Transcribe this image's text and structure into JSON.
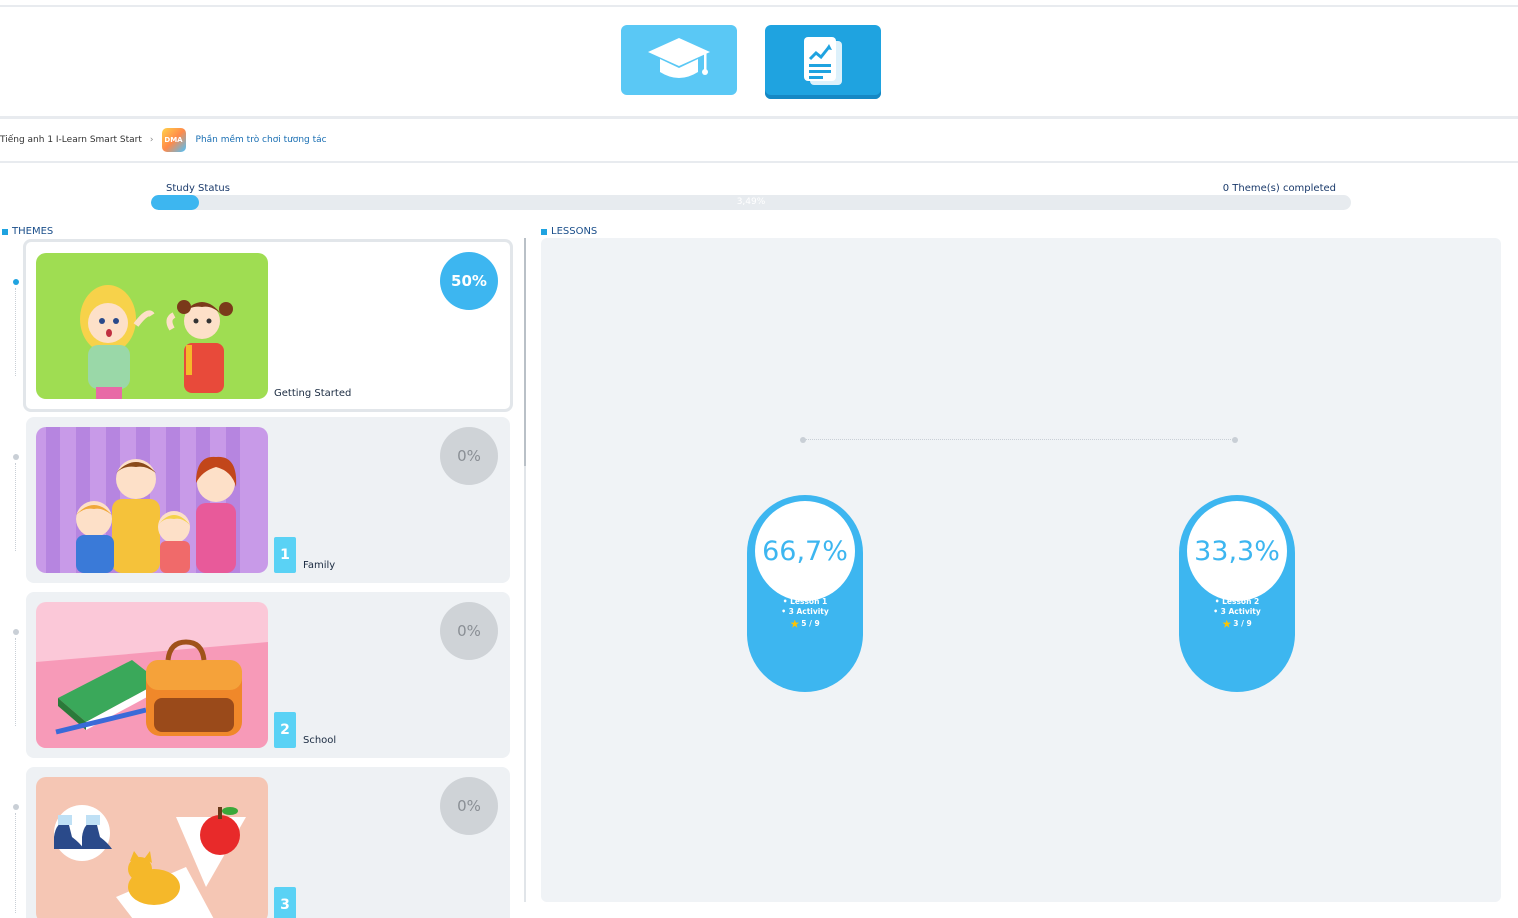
{
  "tabs": [
    {
      "name": "graduation-cap-icon",
      "active": false
    },
    {
      "name": "report-chart-icon",
      "active": true
    }
  ],
  "breadcrumb": {
    "course": "Tiếng anh 1 I-Learn Smart Start",
    "separator": "›",
    "app_logo_text": "DMA",
    "app": "Phần mềm trò chơi tương tác"
  },
  "status": {
    "label": "Study Status",
    "percent_text": "3,49%",
    "percent_value": 3.49,
    "completed_text": "0 Theme(s) completed"
  },
  "sections": {
    "themes": "THEMES",
    "lessons": "LESSONS"
  },
  "themes": [
    {
      "number": "",
      "name": "Getting Started",
      "percent": "50%",
      "active": true
    },
    {
      "number": "1",
      "name": "Family",
      "percent": "0%",
      "active": false
    },
    {
      "number": "2",
      "name": "School",
      "percent": "0%",
      "active": false
    },
    {
      "number": "3",
      "name": "",
      "percent": "0%",
      "active": false
    }
  ],
  "lessons": [
    {
      "percent": "66,7%",
      "lesson": "Lesson 1",
      "activity": "3 Activity",
      "stars": "5 / 9"
    },
    {
      "percent": "33,3%",
      "lesson": "Lesson 2",
      "activity": "3 Activity",
      "stars": "3 / 9"
    }
  ],
  "colors": {
    "accent": "#3db6f0",
    "tab_light": "#5ac8f5",
    "tab_dark": "#1fa3e0",
    "badge_gray": "#cfd3d7"
  }
}
